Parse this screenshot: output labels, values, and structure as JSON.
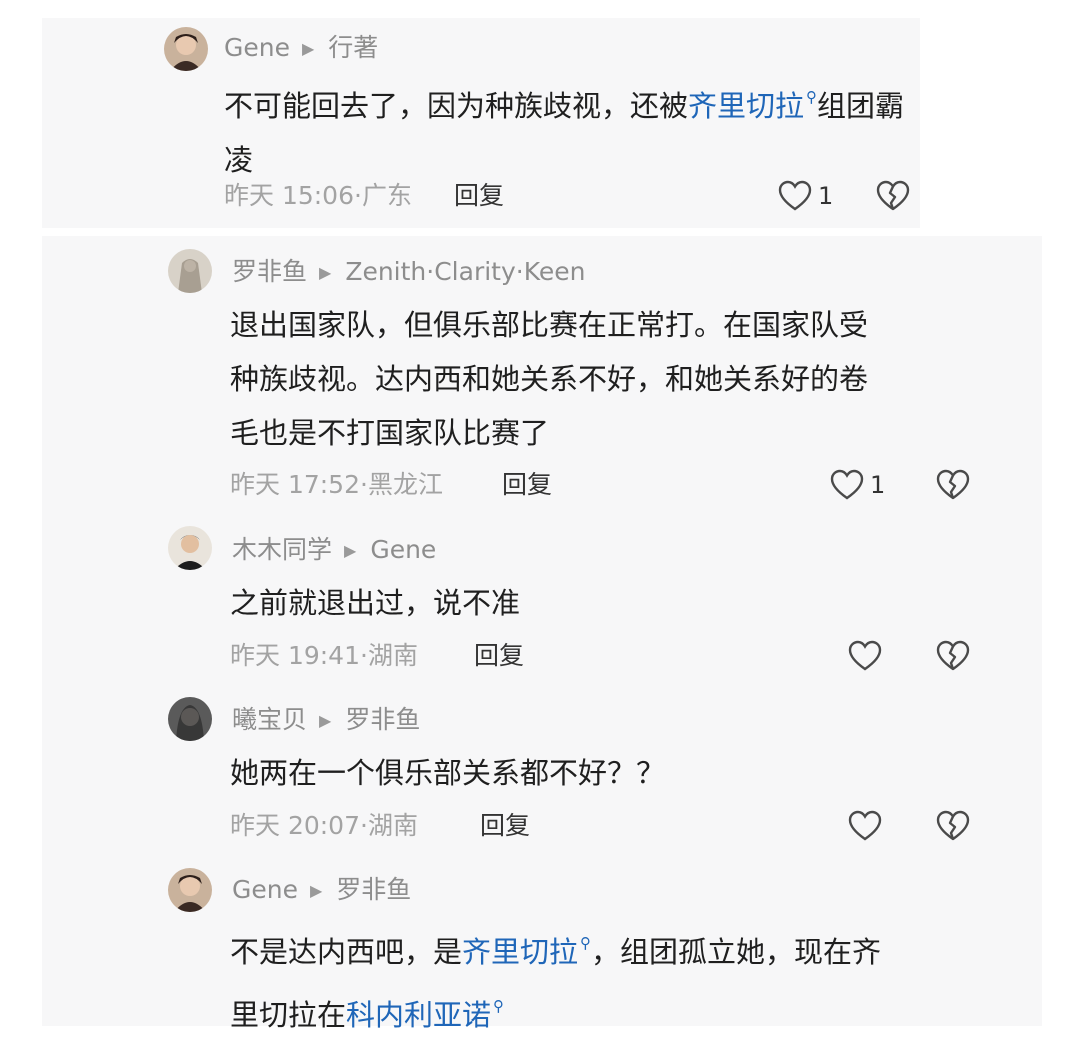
{
  "comments": [
    {
      "author": "Gene",
      "reply_to": "行著",
      "body": [
        "不可能回去了，因为种族歧视，还被",
        "齐里切拉",
        "组团霸凌"
      ],
      "time": "昨天 15:06",
      "location": "广东",
      "reply_label": "回复",
      "likes": "1"
    },
    {
      "author": "罗非鱼",
      "reply_to": "Zenith·Clarity·Keen",
      "body_lines": [
        "退出国家队，但俱乐部比赛在正常打。在国家队受",
        "种族歧视。达内西和她关系不好，和她关系好的卷",
        "毛也是不打国家队比赛了"
      ],
      "time": "昨天 17:52",
      "location": "黑龙江",
      "reply_label": "回复",
      "likes": "1"
    },
    {
      "author": "木木同学",
      "reply_to": "Gene",
      "body_lines": [
        "之前就退出过，说不准"
      ],
      "time": "昨天 19:41",
      "location": "湖南",
      "reply_label": "回复",
      "likes": ""
    },
    {
      "author": "曦宝贝",
      "reply_to": "罗非鱼",
      "body_lines": [
        "她两在一个俱乐部关系都不好？？"
      ],
      "time": "昨天 20:07",
      "location": "湖南",
      "reply_label": "回复",
      "likes": ""
    },
    {
      "author": "Gene",
      "reply_to": "罗非鱼",
      "body_parts": [
        "不是达内西吧，是",
        "齐里切拉",
        "，组团孤立她，现在齐",
        "里切拉在",
        "科内利亚诺"
      ],
      "time": "",
      "location": "",
      "reply_label": "",
      "likes": ""
    }
  ],
  "colors": {
    "link": "#1f66b8",
    "meta": "#8d8d8d",
    "panel": "#f7f7f8"
  },
  "icons": [
    "heart-icon",
    "broken-heart-icon",
    "search-icon",
    "triangle-right-icon"
  ]
}
